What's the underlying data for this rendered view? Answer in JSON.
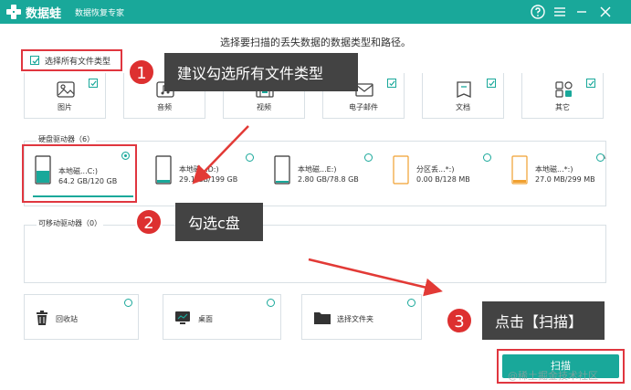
{
  "titlebar": {
    "app_name": "数据蛙",
    "app_subtitle": "数据恢复专家"
  },
  "subtitle": "选择要扫描的丢失数据的数据类型和路径。",
  "select_all": {
    "label": "选择所有文件类型",
    "checked": true
  },
  "file_types": [
    {
      "label": "图片",
      "checked": true
    },
    {
      "label": "音频",
      "checked": true
    },
    {
      "label": "视频",
      "checked": true
    },
    {
      "label": "电子邮件",
      "checked": true
    },
    {
      "label": "文档",
      "checked": true
    },
    {
      "label": "其它",
      "checked": true
    }
  ],
  "hard_drives": {
    "title": "硬盘驱动器（6）",
    "items": [
      {
        "name": "本地磁...C:)",
        "capacity": "64.2 GB/120 GB",
        "selected": true
      },
      {
        "name": "本地磁...D:)",
        "capacity": "29.1 GB/199 GB",
        "selected": false
      },
      {
        "name": "本地磁...E:)",
        "capacity": "2.80 GB/78.8 GB",
        "selected": false
      },
      {
        "name": "分区丢...*:)",
        "capacity": "0.00 B/128 MB",
        "selected": false
      },
      {
        "name": "本地磁...*:)",
        "capacity": "27.0 MB/299 MB",
        "selected": false
      }
    ]
  },
  "removable": {
    "title": "可移动驱动器（0）"
  },
  "locations": [
    {
      "label": "回收站"
    },
    {
      "label": "桌面"
    },
    {
      "label": "选择文件夹"
    }
  ],
  "callouts": [
    {
      "number": "1",
      "text": "建议勾选所有文件类型"
    },
    {
      "number": "2",
      "text": "勾选c盘"
    },
    {
      "number": "3",
      "text": "点击【扫描】"
    }
  ],
  "scan_button": "扫描",
  "watermark": "@稀土掘金技术社区",
  "colors": {
    "accent": "#19a89a",
    "annotation_red": "#e0363f",
    "callout_bg": "#434343"
  }
}
